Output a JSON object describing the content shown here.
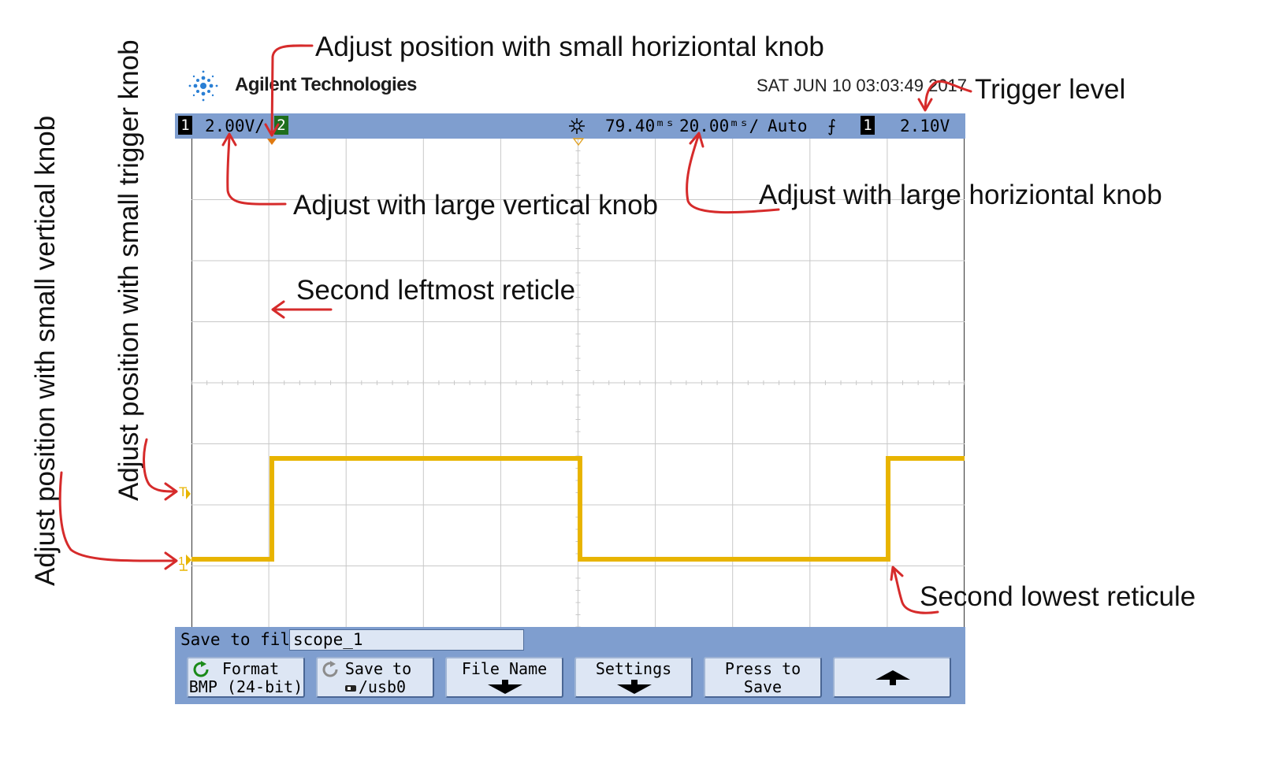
{
  "header": {
    "brand": "Agilent Technologies",
    "datetime": "SAT JUN 10 03:03:49 2017"
  },
  "status_bar": {
    "channel1_badge": "1",
    "channel_scale": "2.00V/",
    "channel2_badge": "2",
    "time_delay": "79.40ᵐˢ",
    "time_base": "20.00ᵐˢ/",
    "trigger_mode": "Auto",
    "trigger_slope": "⨍",
    "trigger_source_badge": "1",
    "trigger_level": "2.10V"
  },
  "waveform": {
    "color": "#e8b400",
    "ground_marker": "1",
    "trigger_marker": "T"
  },
  "save_bar": {
    "label": "Save to file =",
    "filename": "scope_1"
  },
  "softkeys": [
    {
      "line1": "Format",
      "line2": "BMP (24-bit)",
      "icon": "cycle-icon-green"
    },
    {
      "line1": "Save to",
      "line2": "/usb0",
      "icon": "cycle-icon-grey"
    },
    {
      "line1": "File Name",
      "line2": "",
      "icon": "down-arrow-icon"
    },
    {
      "line1": "Settings",
      "line2": "",
      "icon": "down-arrow-icon"
    },
    {
      "line1": "Press to",
      "line2": "Save",
      "icon": ""
    },
    {
      "line1": "",
      "line2": "",
      "icon": "up-arrow-icon"
    }
  ],
  "annotations": {
    "horizontal_position": "Adjust position with small horiziontal knob",
    "trigger_level": "Trigger level",
    "vertical_scale": "Adjust with large vertical knob",
    "horizontal_scale": "Adjust with large horiziontal knob",
    "second_leftmost": "Second leftmost reticle",
    "second_lowest": "Second lowest reticule",
    "trigger_position": "Adjust position with small trigger knob",
    "vertical_position": "Adjust position with small vertical knob"
  },
  "colors": {
    "status_bar": "#7f9ecf",
    "arrow": "#d62b2b",
    "softkey": "#dde6f4"
  }
}
